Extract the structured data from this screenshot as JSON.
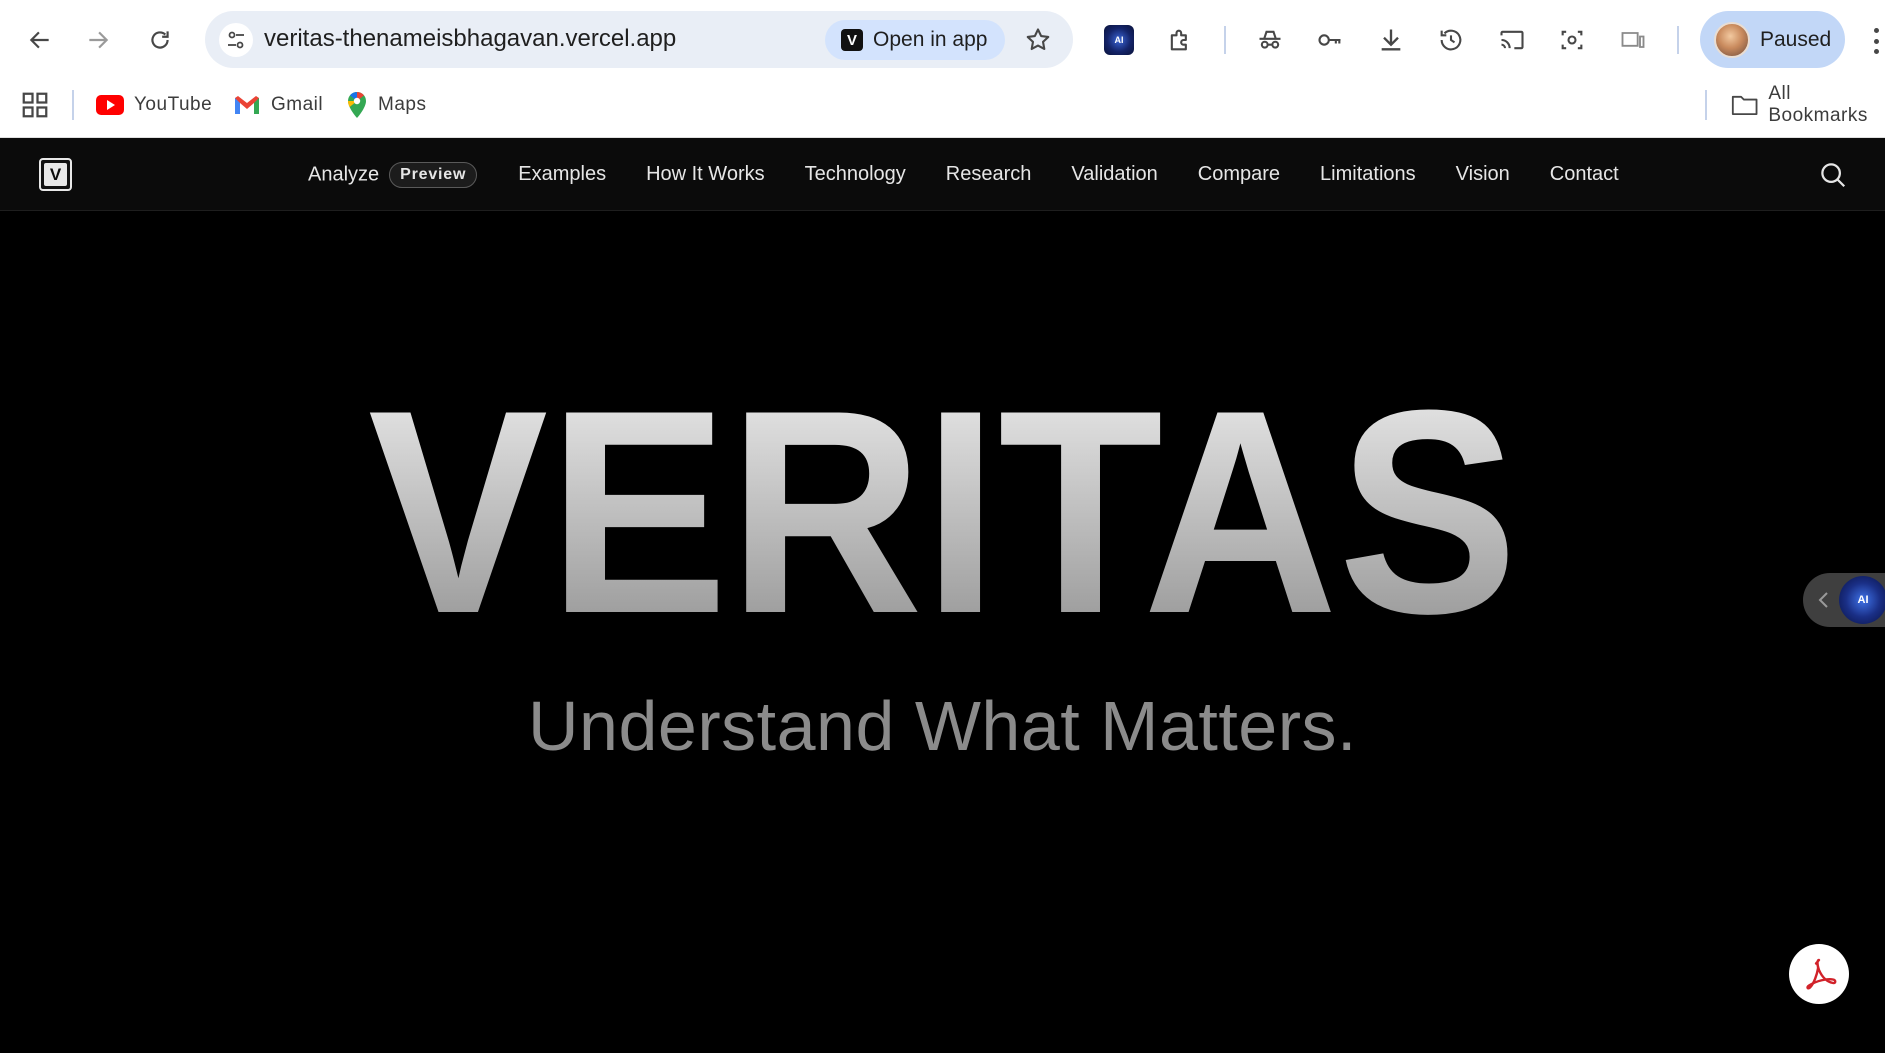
{
  "browser": {
    "url": "veritas-thenameisbhagavan.vercel.app",
    "open_in_app_label": "Open in app",
    "profile_label": "Paused",
    "extension_ai_label": "AI"
  },
  "bookmarks": {
    "items": [
      {
        "label": "YouTube",
        "icon": "youtube-icon"
      },
      {
        "label": "Gmail",
        "icon": "gmail-icon"
      },
      {
        "label": "Maps",
        "icon": "maps-icon"
      }
    ],
    "all_bookmarks_label": "All Bookmarks"
  },
  "site": {
    "logo_letter": "V",
    "nav": [
      {
        "label": "Analyze",
        "badge": "Preview"
      },
      {
        "label": "Examples"
      },
      {
        "label": "How It Works"
      },
      {
        "label": "Technology"
      },
      {
        "label": "Research"
      },
      {
        "label": "Validation"
      },
      {
        "label": "Compare"
      },
      {
        "label": "Limitations"
      },
      {
        "label": "Vision"
      },
      {
        "label": "Contact"
      }
    ]
  },
  "hero": {
    "title": "VERITAS",
    "subtitle": "Understand What Matters."
  },
  "widgets": {
    "side_tab_ai_label": "AI"
  },
  "colors": {
    "page_background": "#000000",
    "header_background": "#0b0b0b",
    "omnibox_background": "#e9eef6",
    "profile_background": "#c2d7f7",
    "subtitle_gray": "#8b8b8b",
    "pdf_red": "#d1222a"
  }
}
